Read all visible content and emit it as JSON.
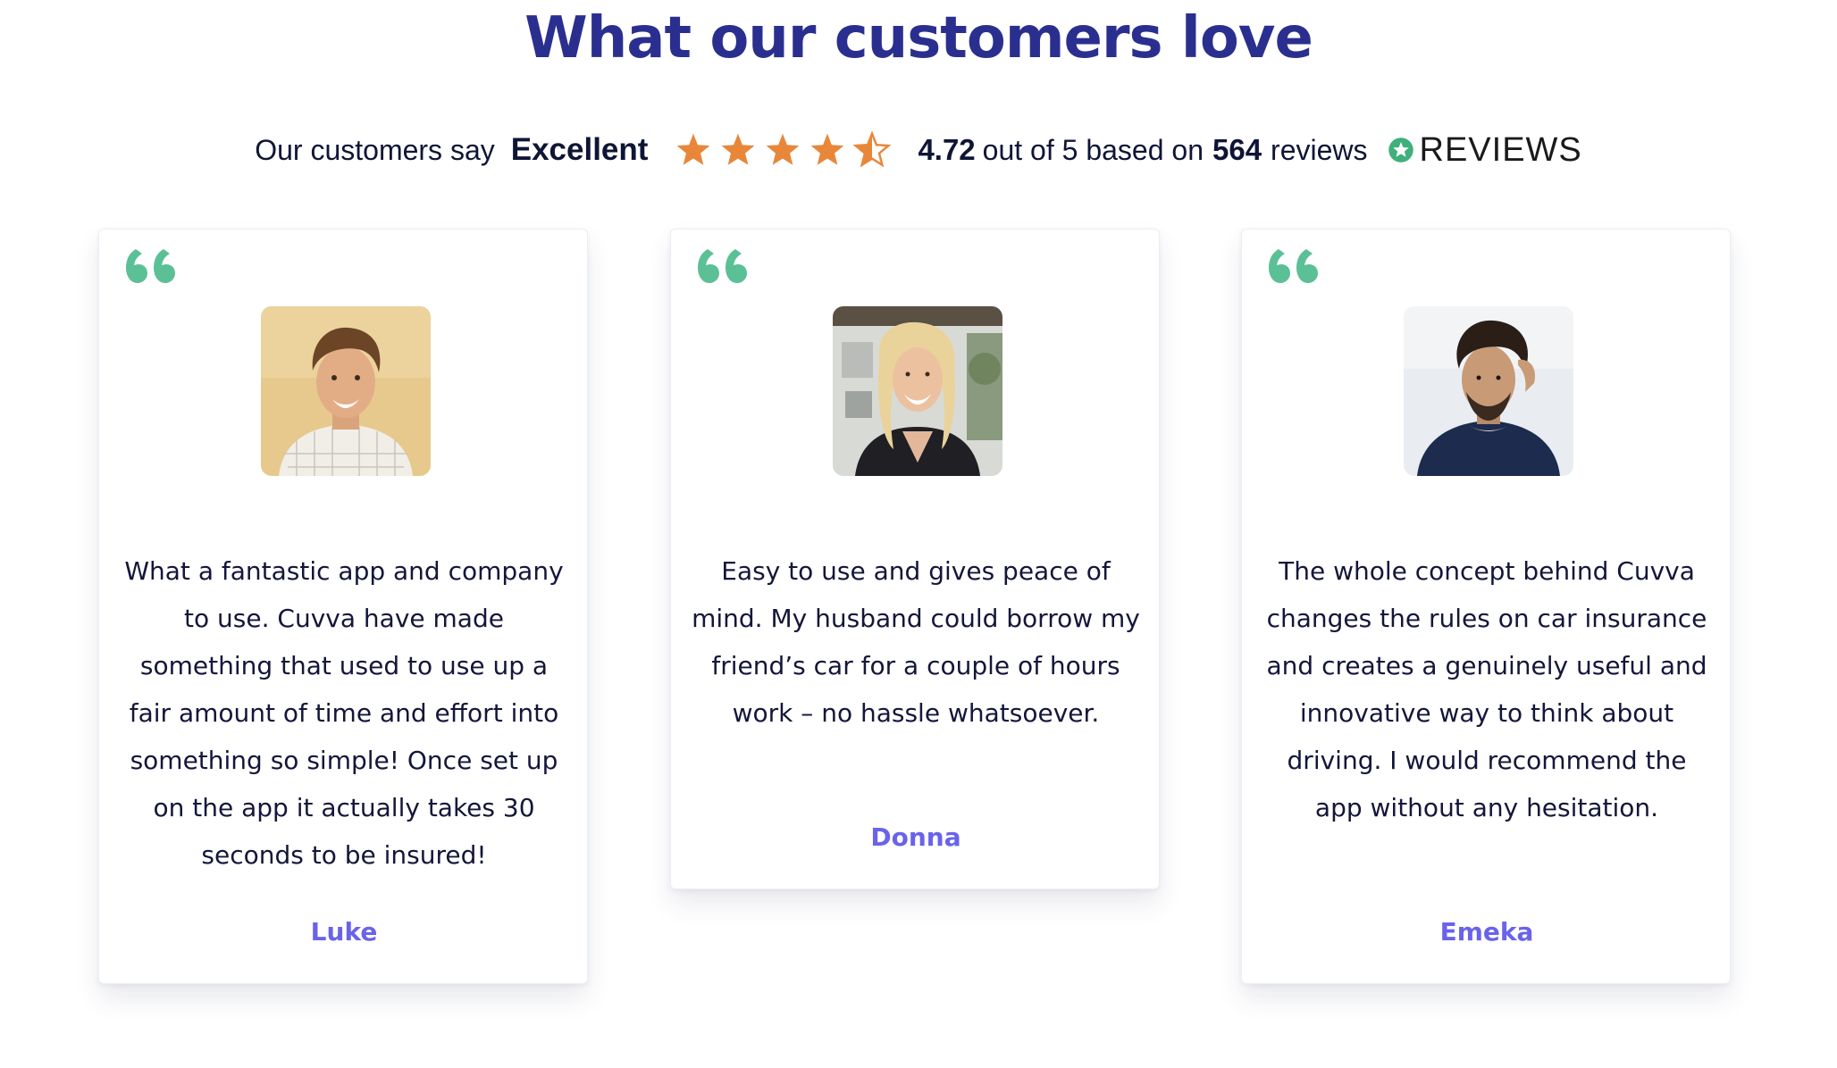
{
  "section": {
    "title": "What our customers love"
  },
  "rating": {
    "prefix": "Our customers say",
    "verdict": "Excellent",
    "stars": 4.5,
    "score": "4.72",
    "out_of_text": "out of 5 based on",
    "count": "564",
    "reviews_word": "reviews",
    "brand": "REVIEWS",
    "star_color": "#e8873a",
    "brand_icon_color": "#3fb07a"
  },
  "colors": {
    "title": "#2a2f8f",
    "quote_mark": "#5cc097",
    "name": "#6a63ea",
    "text": "#14163a"
  },
  "testimonials": [
    {
      "text": "What a fantastic app and company to use. Cuvva have made something that used to use up a fair amount of time and effort into something so simple! Once set up on the app it actually takes 30 seconds to be insured!",
      "name": "Luke",
      "icon": "quote-icon"
    },
    {
      "text": "Easy to use and gives peace of mind. My husband could borrow my friend’s car for a couple of hours work – no hassle whatsoever.",
      "name": "Donna",
      "icon": "quote-icon"
    },
    {
      "text": "The whole concept behind Cuvva changes the rules on car insurance and creates a genuinely useful and innovative way to think about driving. I would recommend the app without any hesitation.",
      "name": "Emeka",
      "icon": "quote-icon"
    }
  ]
}
